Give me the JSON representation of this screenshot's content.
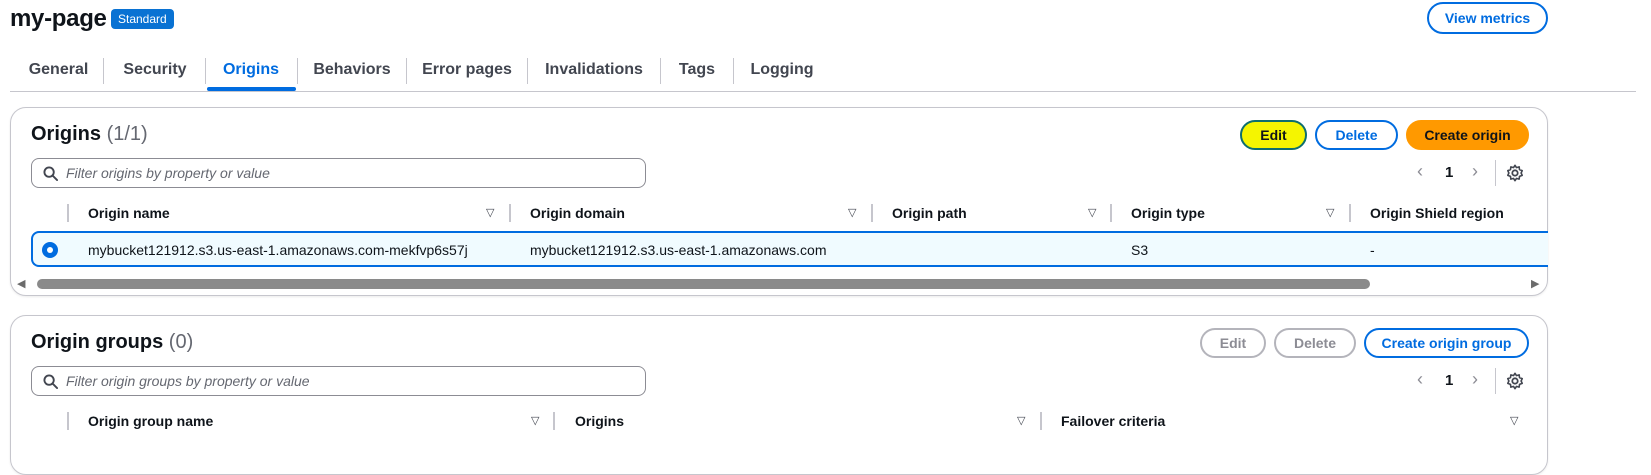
{
  "page": {
    "title": "my-page",
    "badge": "Standard",
    "view_metrics": "View metrics"
  },
  "tabs": [
    {
      "label": "General"
    },
    {
      "label": "Security"
    },
    {
      "label": "Origins"
    },
    {
      "label": "Behaviors"
    },
    {
      "label": "Error pages"
    },
    {
      "label": "Invalidations"
    },
    {
      "label": "Tags"
    },
    {
      "label": "Logging"
    }
  ],
  "active_tab": "Origins",
  "origins": {
    "title": "Origins",
    "count": "(1/1)",
    "edit": "Edit",
    "delete": "Delete",
    "create": "Create origin",
    "filter_placeholder": "Filter origins by property or value",
    "page": "1",
    "columns": [
      "Origin name",
      "Origin domain",
      "Origin path",
      "Origin type",
      "Origin Shield region"
    ],
    "rows": [
      {
        "name": "mybucket121912.s3.us-east-1.amazonaws.com-mekfvp6s57j",
        "domain": "mybucket121912.s3.us-east-1.amazonaws.com",
        "path": "",
        "type": "S3",
        "shield_region": "-",
        "selected": true
      }
    ]
  },
  "origin_groups": {
    "title": "Origin groups",
    "count": "(0)",
    "edit": "Edit",
    "delete": "Delete",
    "create": "Create origin group",
    "filter_placeholder": "Filter origin groups by property or value",
    "page": "1",
    "columns": [
      "Origin group name",
      "Origins",
      "Failover criteria"
    ]
  },
  "colors": {
    "accent": "#006ce0",
    "primary_button": "#ff9900",
    "highlight": "#f5f500"
  }
}
